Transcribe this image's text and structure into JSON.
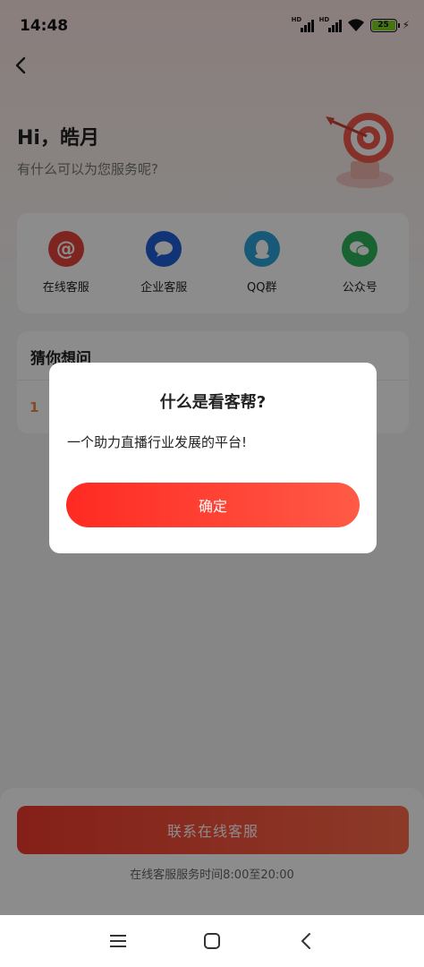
{
  "status_bar": {
    "time": "14:48",
    "signal1_label": "HD",
    "signal2_label": "HD",
    "battery": "25"
  },
  "header": {
    "greeting": "Hi，皓月",
    "subtitle": "有什么可以为您服务呢?"
  },
  "services": [
    {
      "label": "在线客服",
      "icon": "at-icon",
      "color": "#e8443c"
    },
    {
      "label": "企业客服",
      "icon": "chat-bubble-icon",
      "color": "#1e5fd6"
    },
    {
      "label": "QQ群",
      "icon": "penguin-icon",
      "color": "#2aa3d8"
    },
    {
      "label": "公众号",
      "icon": "wechat-icon",
      "color": "#2eb35a"
    }
  ],
  "faq": {
    "title": "猜你想问",
    "first_index": "1"
  },
  "bottom": {
    "contact_button": "联系在线客服",
    "service_hours": "在线客服服务时间8:00至20:00"
  },
  "dialog": {
    "title": "什么是看客帮?",
    "message": "一个助力直播行业发展的平台!",
    "confirm_label": "确定"
  },
  "colors": {
    "accent": "#ff3a2e",
    "overlay": "rgba(0,0,0,0.45)"
  }
}
